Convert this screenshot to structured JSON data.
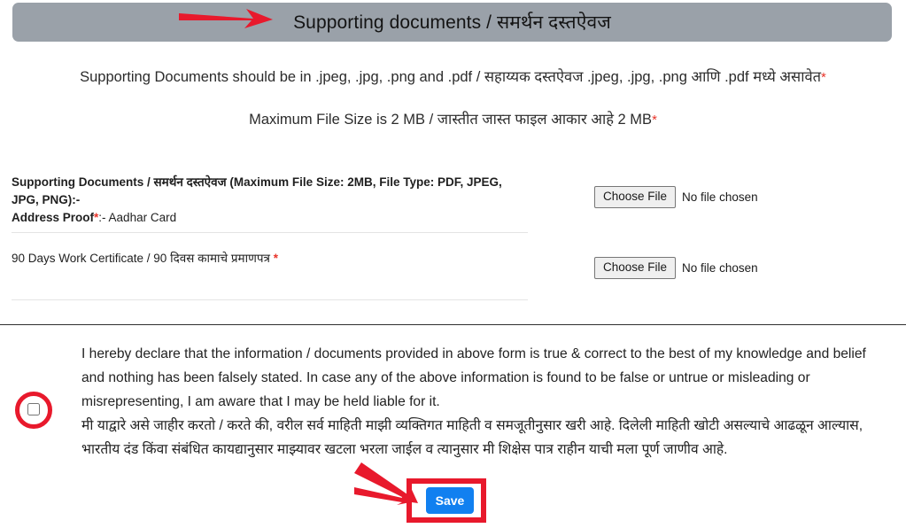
{
  "section": {
    "header_title": "Supporting documents / समर्थन दस्तऐवज"
  },
  "instructions": {
    "line1": "Supporting Documents should be in .jpeg, .jpg, .png and .pdf / सहाय्यक दस्तऐवज .jpeg, .jpg, .png आणि .pdf मध्ये असावेत",
    "line1_star": "*",
    "line2": "Maximum File Size is 2 MB / जास्तीत जास्त फाइल आकार आहे 2 MB",
    "line2_star": "*"
  },
  "uploads": [
    {
      "label_line1": "Supporting Documents / समर्थन दस्तऐवज (Maximum File Size: 2MB, File Type: PDF, JPEG, JPG, PNG):-",
      "label_line2": "Address Proof",
      "label_star": "*",
      "label_suffix": ":- Aadhar Card",
      "button_label": "Choose File",
      "status": "No file chosen"
    },
    {
      "label_line1": "90 Days Work Certificate / 90 दिवस कामाचे प्रमाणपत्र",
      "label_star": "*",
      "button_label": "Choose File",
      "status": "No file chosen"
    }
  ],
  "declaration": {
    "english": "I hereby declare that the information / documents provided in above form is true & correct to the best of my knowledge and belief and nothing has been falsely stated. In case any of the above information is found to be false or untrue or misleading or misrepresenting, I am aware that I may be held liable for it.",
    "marathi": "मी याद्वारे असे जाहीर करतो / करते की, वरील सर्व माहिती माझी व्यक्तिगत माहिती व समजूतीनुसार खरी आहे. दिलेली माहिती खोटी असल्याचे आढळून आल्यास, भारतीय दंड किंवा संबंधित कायद्यानुसार माझ्यावर खटला भरला जाईल व त्यानुसार मी शिक्षेस पात्र राहीन याची मला पूर्ण जाणीव आहे.",
    "checkbox_checked": false
  },
  "actions": {
    "save_label": "Save"
  },
  "colors": {
    "header_bar": "#9aa1a9",
    "save_button": "#1180f0",
    "annotation_red": "#e8192c",
    "required_star": "#e8342a"
  }
}
